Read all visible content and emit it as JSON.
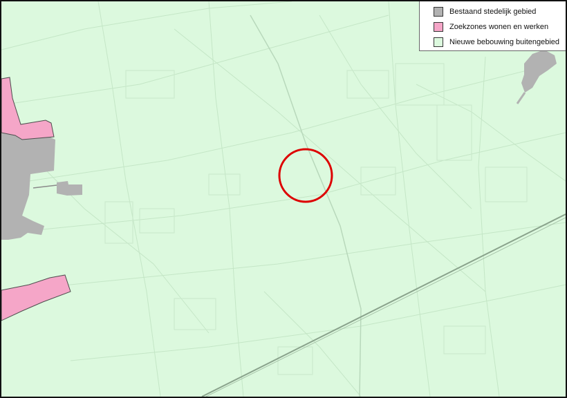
{
  "legend": {
    "items": [
      {
        "label": "Bestaand stedelijk gebied",
        "color": "#b2b2b2"
      },
      {
        "label": "Zoekzones wonen en werken",
        "color": "#f5a6c8"
      },
      {
        "label": "Nieuwe bebouwing buitengebied",
        "color": "#dcf9de"
      }
    ]
  },
  "map": {
    "background_color": "#dcf9de",
    "urban_color": "#b2b2b2",
    "search_zone_color": "#f5a6c8",
    "marker_color": "#dd0000",
    "marker": "red-circle-marker"
  }
}
